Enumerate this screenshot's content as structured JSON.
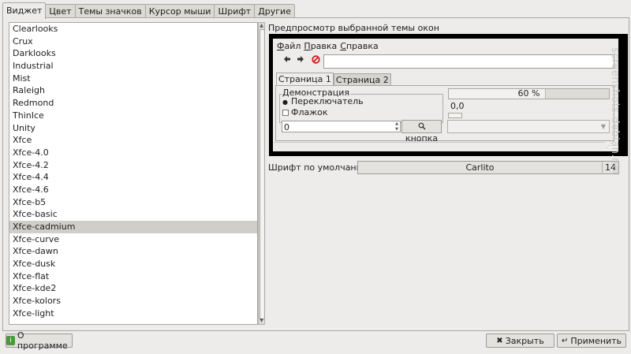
{
  "tabs": [
    {
      "label": "Виджет",
      "active": true
    },
    {
      "label": "Цвет",
      "active": false
    },
    {
      "label": "Темы значков",
      "active": false
    },
    {
      "label": "Курсор мыши",
      "active": false
    },
    {
      "label": "Шрифт",
      "active": false
    },
    {
      "label": "Другие",
      "active": false
    }
  ],
  "themes": {
    "items": [
      "Clearlooks",
      "Crux",
      "Darklooks",
      "Industrial",
      "Mist",
      "Raleigh",
      "Redmond",
      "ThinIce",
      "Unity",
      "Xfce",
      "Xfce-4.0",
      "Xfce-4.2",
      "Xfce-4.4",
      "Xfce-4.6",
      "Xfce-b5",
      "Xfce-basic",
      "Xfce-cadmium",
      "Xfce-curve",
      "Xfce-dawn",
      "Xfce-dusk",
      "Xfce-flat",
      "Xfce-kde2",
      "Xfce-kolors",
      "Xfce-light"
    ],
    "selected": "Xfce-cadmium"
  },
  "preview": {
    "title": "Предпросмотр выбранной темы окон",
    "menu": [
      {
        "underline": "Ф",
        "rest": "айл"
      },
      {
        "underline": "П",
        "rest": "равка"
      },
      {
        "underline": "С",
        "rest": "правка"
      }
    ],
    "toolbar_icons": [
      "back-arrow-icon",
      "forward-arrow-icon",
      "stop-icon"
    ],
    "address_value": "",
    "tabs": [
      "Страница 1",
      "Страница 2"
    ],
    "group_title": "Демонстрация",
    "radio_label": "Переключатель",
    "checkbox_label": "Флажок",
    "spin_value": "0",
    "button_label": "кнопка",
    "progress_text": "60 %",
    "progress_value": 0.6,
    "scale_value": "0,0",
    "combo_value": ""
  },
  "font": {
    "label": "Шрифт по умолчанию:",
    "name": "Carlito",
    "size": "14"
  },
  "buttons": {
    "about": "О программе",
    "close": "Закрыть",
    "apply": "Применить"
  },
  "watermark": "screenshots.debian.net"
}
